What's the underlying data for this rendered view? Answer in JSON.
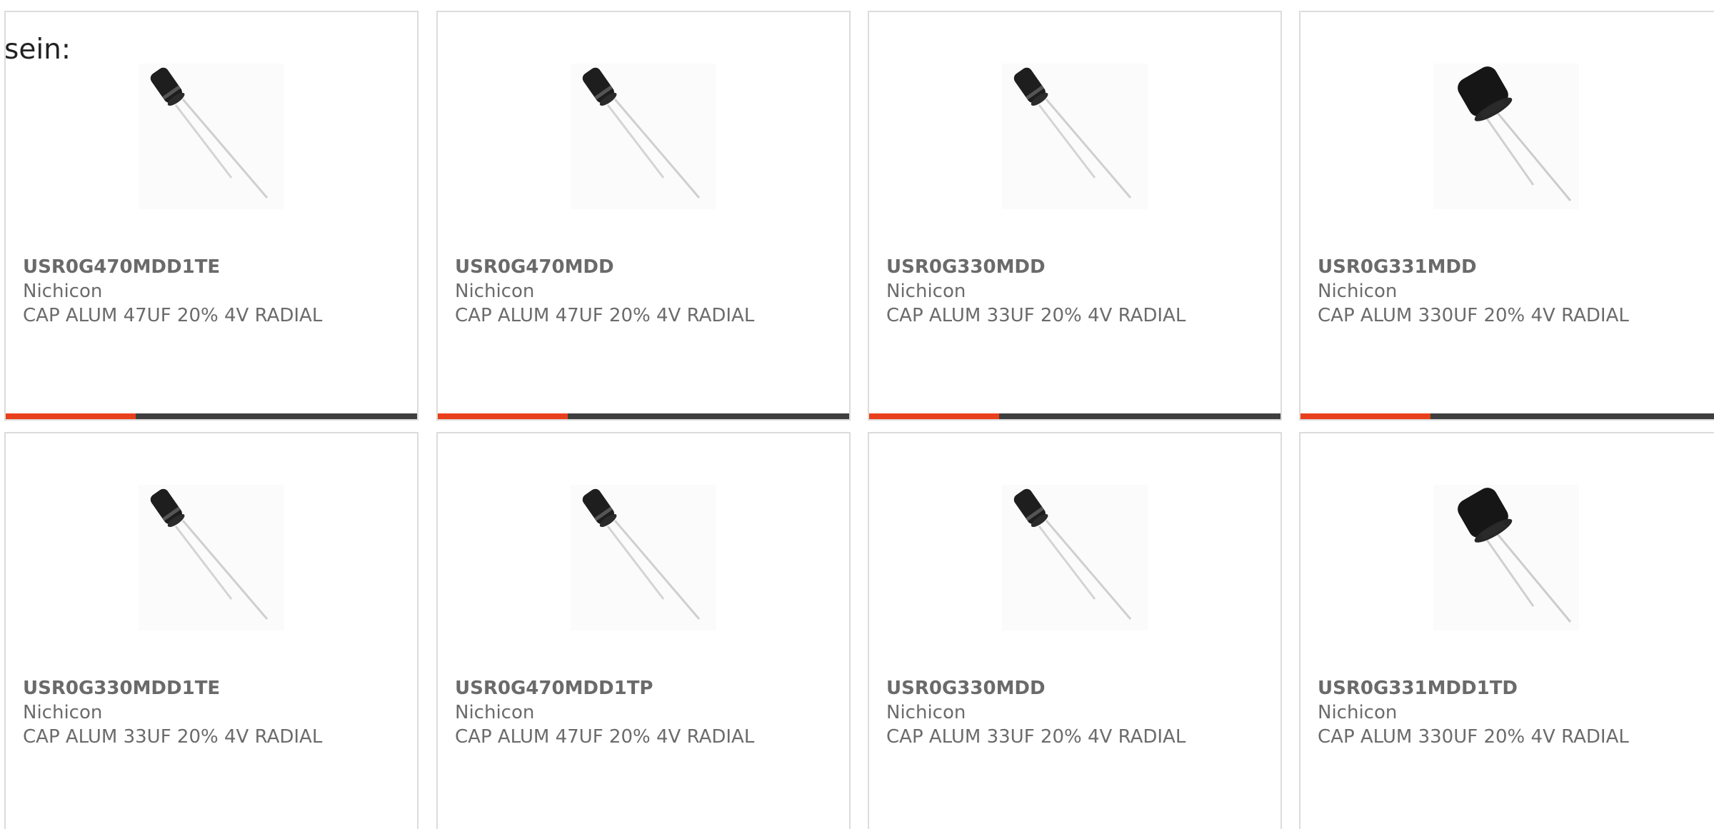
{
  "intro": {
    "text": "sein:"
  },
  "colors": {
    "accent": "#e8401c",
    "bar": "#3f3f3f",
    "border": "#dcdcdc",
    "text": "#6b6b6b"
  },
  "products": [
    {
      "part_number": "USR0G470MDD1TE",
      "manufacturer": "Nichicon",
      "description": "CAP ALUM 47UF 20% 4V RADIAL",
      "image_icon": "small-radial-capacitor-image"
    },
    {
      "part_number": "USR0G470MDD",
      "manufacturer": "Nichicon",
      "description": "CAP ALUM 47UF 20% 4V RADIAL",
      "image_icon": "small-radial-capacitor-image"
    },
    {
      "part_number": "USR0G330MDD",
      "manufacturer": "Nichicon",
      "description": "CAP ALUM 33UF 20% 4V RADIAL",
      "image_icon": "small-radial-capacitor-image"
    },
    {
      "part_number": "USR0G331MDD",
      "manufacturer": "Nichicon",
      "description": "CAP ALUM 330UF 20% 4V RADIAL",
      "image_icon": "large-radial-capacitor-image"
    },
    {
      "part_number": "USR0G330MDD1TE",
      "manufacturer": "Nichicon",
      "description": "CAP ALUM 33UF 20% 4V RADIAL",
      "image_icon": "small-radial-capacitor-image"
    },
    {
      "part_number": "USR0G470MDD1TP",
      "manufacturer": "Nichicon",
      "description": "CAP ALUM 47UF 20% 4V RADIAL",
      "image_icon": "small-radial-capacitor-image"
    },
    {
      "part_number": "USR0G330MDD",
      "manufacturer": "Nichicon",
      "description": "CAP ALUM 33UF 20% 4V RADIAL",
      "image_icon": "small-radial-capacitor-image"
    },
    {
      "part_number": "USR0G331MDD1TD",
      "manufacturer": "Nichicon",
      "description": "CAP ALUM 330UF 20% 4V RADIAL",
      "image_icon": "large-radial-capacitor-image"
    }
  ]
}
